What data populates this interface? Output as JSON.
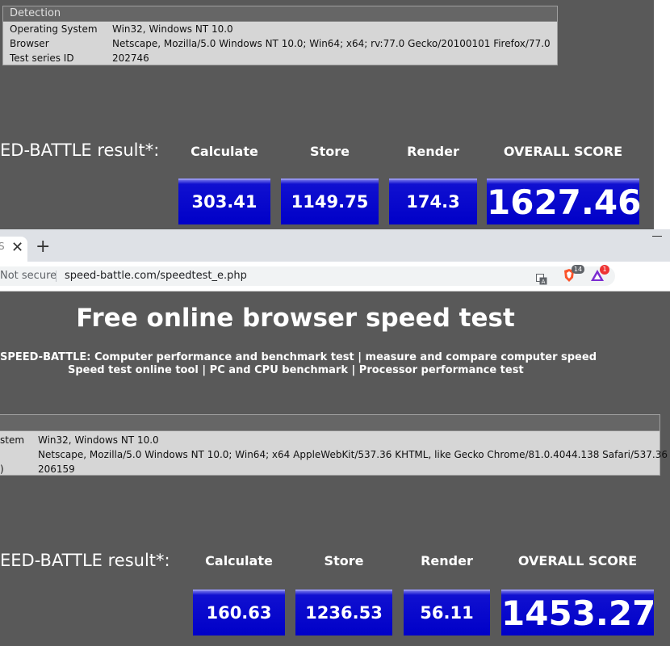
{
  "top": {
    "detection": {
      "title": "Detection",
      "rows": [
        {
          "label": "Operating System",
          "value": "Win32, Windows NT 10.0"
        },
        {
          "label": "Browser",
          "value": "Netscape, Mozilla/5.0 Windows NT 10.0; Win64; x64; rv:77.0 Gecko/20100101 Firefox/77.0"
        },
        {
          "label": "Test series ID",
          "value": "202746"
        }
      ]
    },
    "result_label": "ED-BATTLE result*:",
    "columns": [
      "Calculate",
      "Store",
      "Render",
      "OVERALL SCORE"
    ],
    "scores": {
      "calculate": "303.41",
      "store": "1149.75",
      "render": "174.3",
      "overall": "1627.46"
    }
  },
  "bottom": {
    "tab": {
      "close": "✕",
      "new_tab": "+",
      "title_fragment": "S"
    },
    "address": {
      "security": "Not secure",
      "url": "speed-battle.com/speedtest_e.php",
      "brave_count": "14",
      "alert_count": "1"
    },
    "title": "Free online browser speed test",
    "subtitle_1": "SPEED-BATTLE: Computer performance and benchmark test | measure and compare computer speed",
    "subtitle_2": "Speed test online tool | PC and CPU benchmark | Processor performance test",
    "detection": {
      "rows": [
        {
          "label": "stem",
          "value": "Win32, Windows NT 10.0"
        },
        {
          "label": "",
          "value": "Netscape, Mozilla/5.0 Windows NT 10.0; Win64; x64 AppleWebKit/537.36 KHTML, like Gecko Chrome/81.0.4044.138 Safari/537.36"
        },
        {
          "label": ")",
          "value": "206159"
        }
      ]
    },
    "result_label": "EED-BATTLE result*:",
    "columns": [
      "Calculate",
      "Store",
      "Render",
      "OVERALL SCORE"
    ],
    "scores": {
      "calculate": "160.63",
      "store": "1236.53",
      "render": "56.11",
      "overall": "1453.27"
    }
  },
  "colors": {
    "page_bg": "#595959",
    "score_blue": "#0000c8",
    "detection_bg": "#d6d6d6"
  }
}
